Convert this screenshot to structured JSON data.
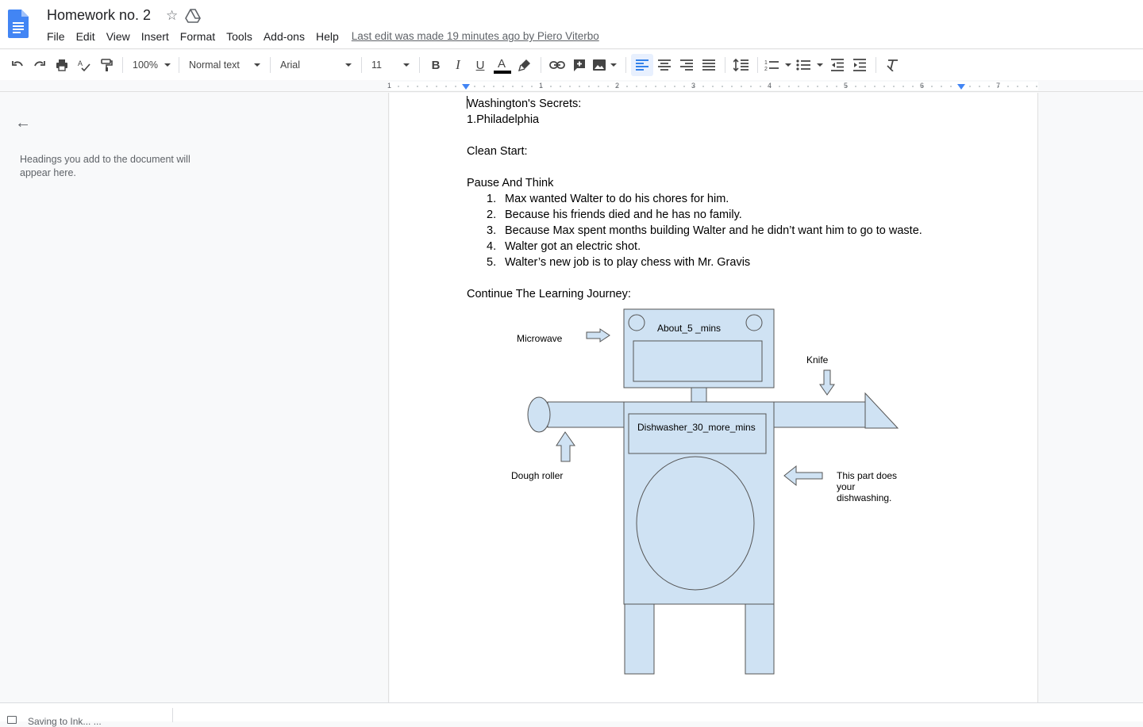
{
  "app": {
    "title": "Homework no. 2",
    "last_edit": "Last edit was made 19 minutes ago by Piero Viterbo",
    "menu": [
      "File",
      "Edit",
      "View",
      "Insert",
      "Format",
      "Tools",
      "Add-ons",
      "Help"
    ]
  },
  "toolbar": {
    "zoom": "100%",
    "style": "Normal text",
    "font": "Arial",
    "size": "11"
  },
  "ruler": {
    "labels": [
      "1",
      "1",
      "2",
      "3",
      "4",
      "5",
      "6",
      "7"
    ]
  },
  "outline": {
    "hint": "Headings you add to the document will appear here."
  },
  "document": {
    "line1": "Washington's Secrets:",
    "line2": "1.Philadelphia",
    "line3": "Clean Start:",
    "line4": "Pause And Think",
    "list": [
      {
        "num": "1.",
        "text": "Max wanted Walter to do his chores for him."
      },
      {
        "num": "2.",
        "text": "Because his friends died and he has no family."
      },
      {
        "num": "3.",
        "text": "Because Max spent months building Walter and he didn’t want him to go to waste."
      },
      {
        "num": "4.",
        "text": "Walter got an electric shot."
      },
      {
        "num": "5.",
        "text": "Walter’s new job is to play chess with Mr. Gravis"
      }
    ],
    "line5": "Continue The Learning Journey:"
  },
  "drawing": {
    "head_label": "About_5 _mins",
    "body_label": "Dishwasher_30_more_mins",
    "microwave": "Microwave",
    "knife": "Knife",
    "dough_roller": "Dough roller",
    "dish_note_1": "This part does",
    "dish_note_2": "your",
    "dish_note_3": "dishwashing.",
    "fill_color": "#cfe2f3"
  },
  "status": {
    "text": "Saving to Ink... ..."
  }
}
